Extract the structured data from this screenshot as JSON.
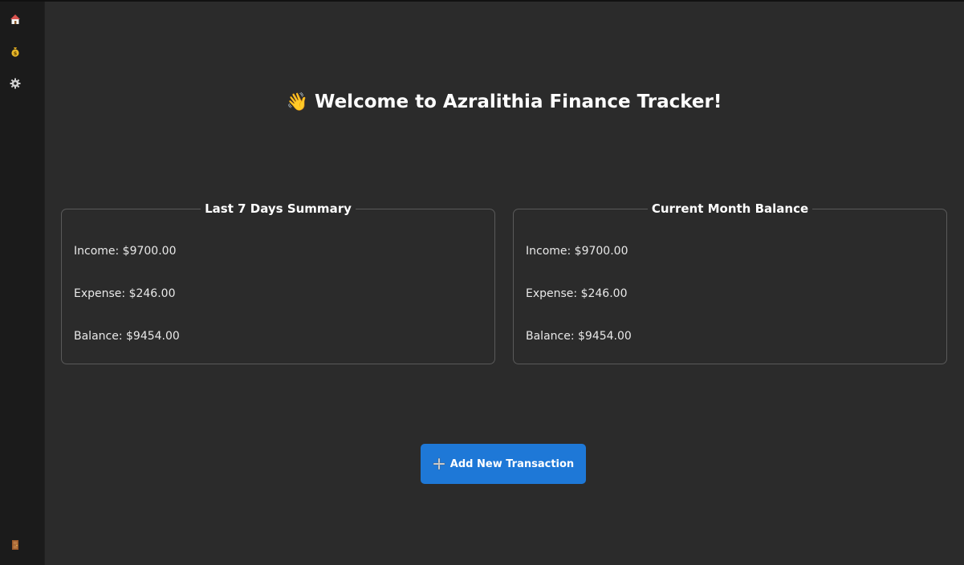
{
  "sidebar": {
    "items": [
      {
        "icon": "home-icon"
      },
      {
        "icon": "money-bag-icon"
      },
      {
        "icon": "gear-icon"
      }
    ],
    "bottom_icon": "exit-door-icon"
  },
  "header": {
    "emoji": "👋",
    "title": "Welcome to Azralithia Finance Tracker!"
  },
  "panels": [
    {
      "title": "Last 7 Days Summary",
      "income": "Income: $9700.00",
      "expense": "Expense: $246.00",
      "balance": "Balance: $9454.00"
    },
    {
      "title": "Current Month Balance",
      "income": "Income: $9700.00",
      "expense": "Expense: $246.00",
      "balance": "Balance: $9454.00"
    }
  ],
  "actions": {
    "add_label": "Add New Transaction",
    "add_icon": "plus-icon"
  },
  "colors": {
    "background": "#2b2b2b",
    "sidebar": "#1b1b1b",
    "accent": "#1e78d7",
    "panel_border": "#5a5a5a"
  }
}
